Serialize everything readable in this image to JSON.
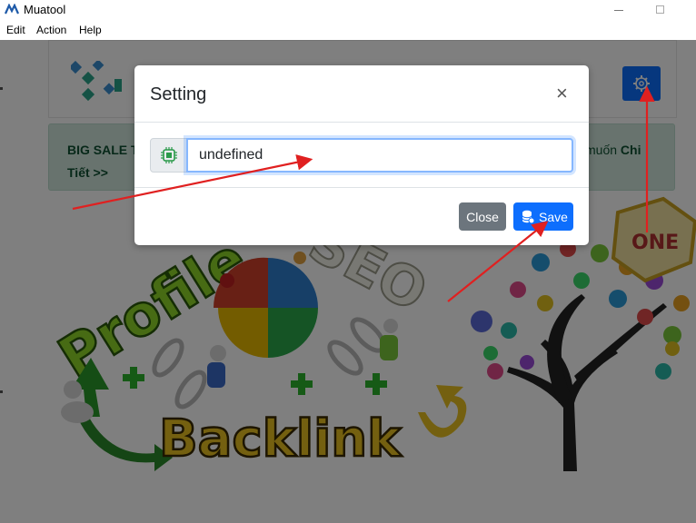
{
  "window": {
    "title": "Muatool"
  },
  "menu": {
    "items": [
      "Edit",
      "Action",
      "Help"
    ]
  },
  "sale_banner": {
    "left_text": "BIG SALE T... Tiết >>",
    "left_line1": "BIG SALE T",
    "left_line2": "Tiết >>",
    "right_text": "muốn",
    "right_bold": "Chi"
  },
  "banner": {
    "word_profile": "Profile",
    "word_backlink": "Backlink",
    "word_seo": "SEO",
    "word_one": "ONE"
  },
  "dialog": {
    "title": "Setting",
    "close_symbol": "×",
    "input_value": "undefined",
    "close_button": "Close",
    "save_button": "Save"
  },
  "colors": {
    "primary": "#0d6efd",
    "secondary": "#6c757d",
    "annotation_arrow": "#e02020",
    "sale_bg": "#d1e7dd"
  },
  "icons": {
    "app": "muatool-logo-icon",
    "settings": "gear-icon",
    "input_addon": "chip-icon",
    "save": "database-icon"
  }
}
